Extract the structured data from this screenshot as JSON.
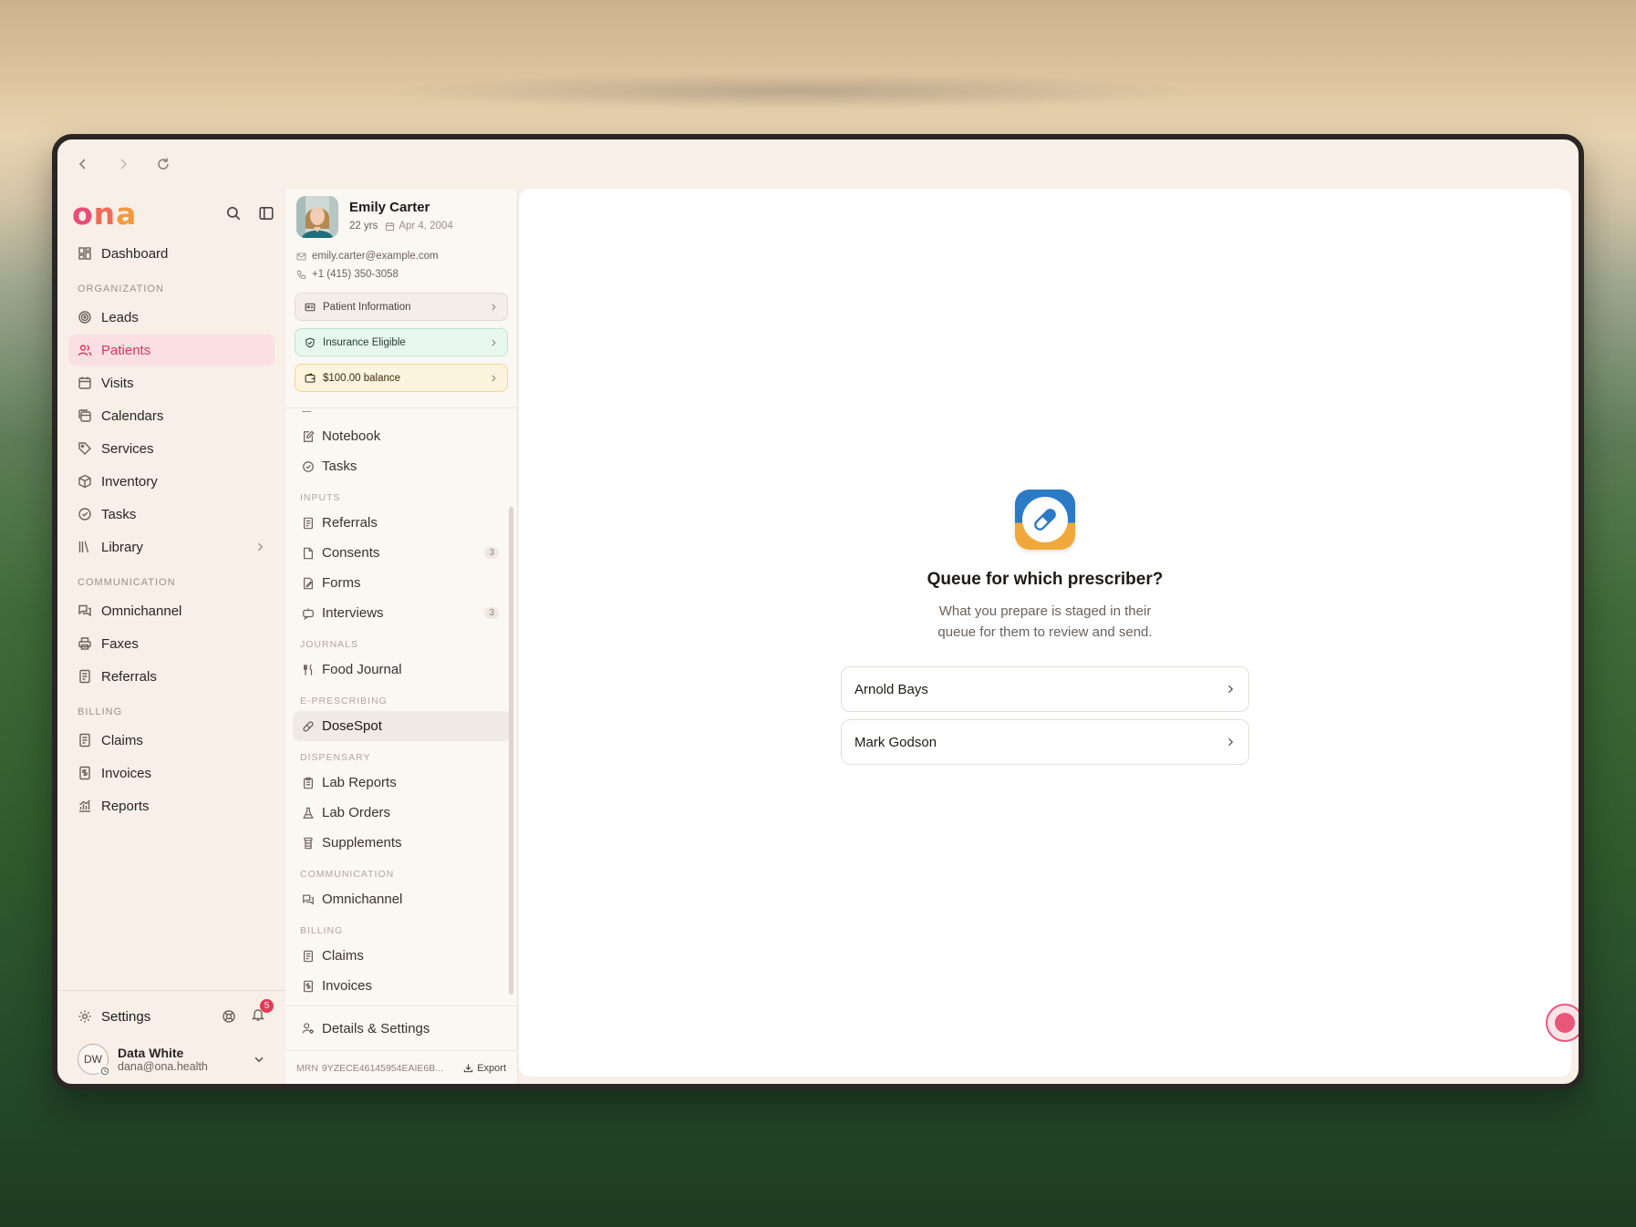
{
  "browser": {
    "back": "back",
    "forward": "forward",
    "reload": "reload"
  },
  "brand": {
    "logo_parts": [
      "o",
      "n",
      "a"
    ]
  },
  "sidebar": {
    "dashboard": "Dashboard",
    "sections": [
      {
        "label": "ORGANIZATION",
        "items": [
          "Leads",
          "Patients",
          "Visits",
          "Calendars",
          "Services",
          "Inventory",
          "Tasks",
          "Library"
        ]
      },
      {
        "label": "COMMUNICATION",
        "items": [
          "Omnichannel",
          "Faxes",
          "Referrals"
        ]
      },
      {
        "label": "BILLING",
        "items": [
          "Claims",
          "Invoices",
          "Reports"
        ]
      }
    ],
    "active_item": "Patients",
    "settings": "Settings",
    "notification_count": "5",
    "user": {
      "initials": "DW",
      "name": "Data White",
      "email": "dana@ona.health"
    }
  },
  "patient": {
    "name": "Emily Carter",
    "age": "22 yrs",
    "dob": "Apr 4, 2004",
    "email": "emily.carter@example.com",
    "phone": "+1 (415) 350-3058",
    "info_pill": "Patient Information",
    "insurance_pill": "Insurance Eligible",
    "balance_pill": "$100.00 balance",
    "nav": {
      "top": [
        "Notebook",
        "Tasks"
      ],
      "inputs_label": "INPUTS",
      "inputs": [
        {
          "label": "Referrals"
        },
        {
          "label": "Consents",
          "count": "3"
        },
        {
          "label": "Forms"
        },
        {
          "label": "Interviews",
          "count": "3"
        }
      ],
      "journals_label": "JOURNALS",
      "journals": [
        "Food Journal"
      ],
      "eprescribing_label": "E-PRESCRIBING",
      "eprescribing": [
        "DoseSpot"
      ],
      "dispensary_label": "DISPENSARY",
      "dispensary": [
        "Lab Reports",
        "Lab Orders",
        "Supplements"
      ],
      "communication_label": "COMMUNICATION",
      "communication": [
        "Omnichannel"
      ],
      "billing_label": "BILLING",
      "billing": [
        "Claims",
        "Invoices"
      ]
    },
    "details_settings": "Details & Settings",
    "mrn_label": "MRN",
    "mrn_value": "9YZECE46145954EAIE6B...",
    "export": "Export"
  },
  "main": {
    "title": "Queue for which prescriber?",
    "subtitle": "What you prepare is staged in their queue for them to review and send.",
    "prescribers": [
      "Arnold Bays",
      "Mark Godson"
    ]
  }
}
